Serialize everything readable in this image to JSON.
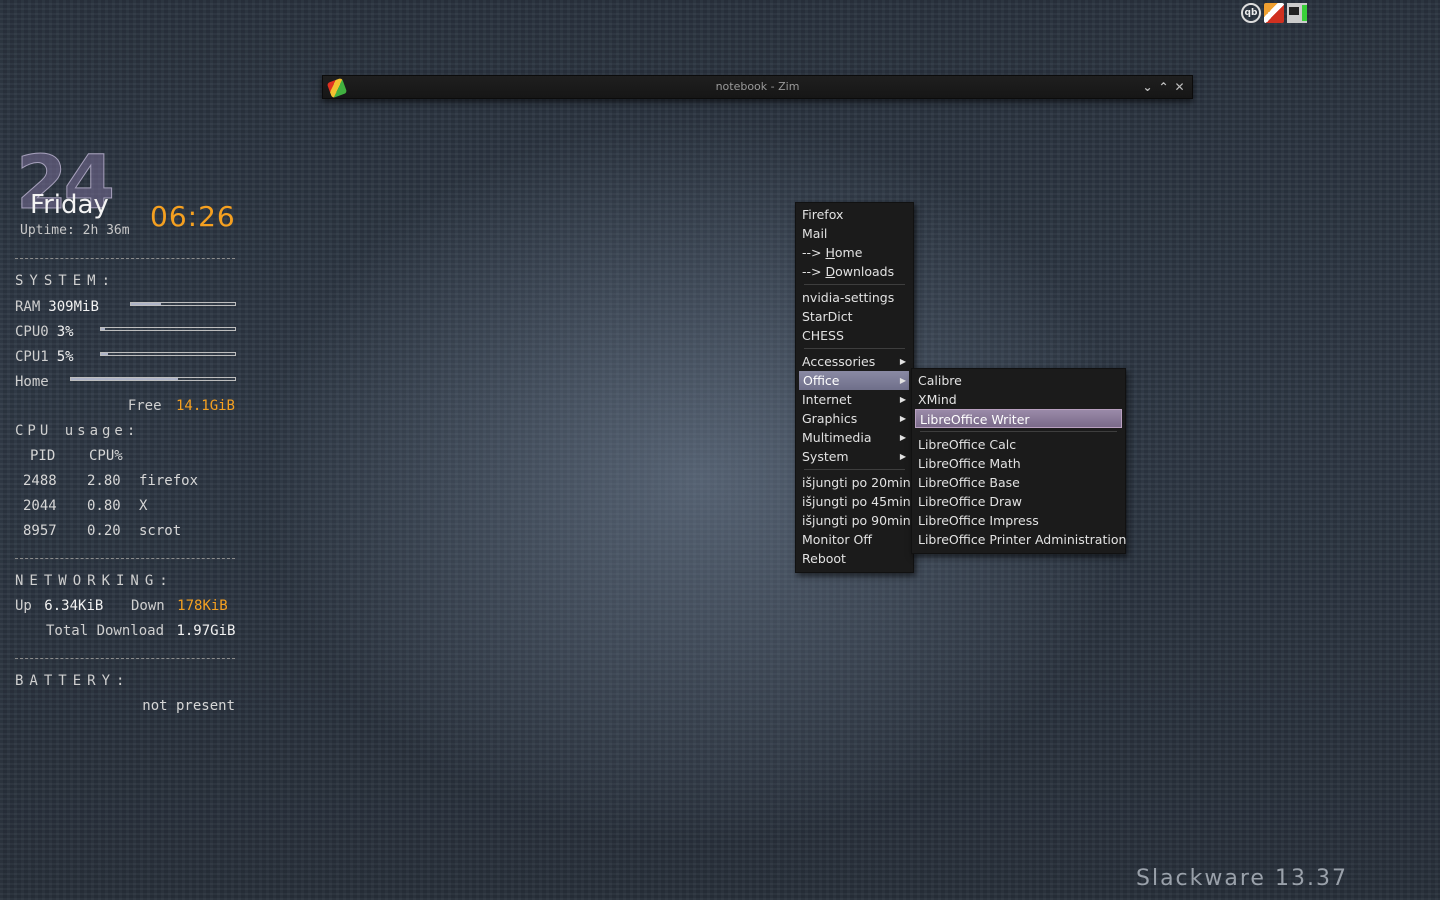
{
  "tray": {
    "qb_label": "qb"
  },
  "window": {
    "title": "notebook - Zim",
    "min_glyph": "⌄",
    "max_glyph": "⌃",
    "close_glyph": "✕"
  },
  "conky": {
    "day_number": "24",
    "day_name": "Friday",
    "time": "06:26",
    "uptime": "Uptime: 2h 36m",
    "system_heading": "SYSTEM:",
    "ram_label": "RAM",
    "ram_value": "309MiB",
    "ram_fraction": 0.29,
    "cpu0_label": "CPU0",
    "cpu0_value": "3%",
    "cpu0_fraction": 0.03,
    "cpu1_label": "CPU1",
    "cpu1_value": "5%",
    "cpu1_fraction": 0.05,
    "home_label": "Home",
    "home_fraction": 0.65,
    "free_label": "Free",
    "free_value": "14.1GiB",
    "cpu_usage_heading": "CPU usage:",
    "proc_headers": {
      "pid": "PID",
      "cpu": "CPU%"
    },
    "processes": [
      {
        "pid": "2488",
        "cpu": "2.80",
        "name": "firefox"
      },
      {
        "pid": "2044",
        "cpu": "0.80",
        "name": "X"
      },
      {
        "pid": "8957",
        "cpu": "0.20",
        "name": "scrot"
      }
    ],
    "networking_heading": "NETWORKING:",
    "up_label": "Up",
    "up_value": "6.34KiB",
    "down_label": "Down",
    "down_value": "178KiB",
    "total_label": "Total Download",
    "total_value": "1.97GiB",
    "battery_heading": "BATTERY:",
    "battery_value": "not present"
  },
  "menu": {
    "firefox": "Firefox",
    "mail": "Mail",
    "home_prefix": "--> ",
    "home_access": "H",
    "home_rest": "ome",
    "downloads_prefix": "--> ",
    "downloads_access": "D",
    "downloads_rest": "ownloads",
    "nvidia": "nvidia-settings",
    "stardict": "StarDict",
    "chess": "CHESS",
    "accessories": "Accessories",
    "office": "Office",
    "internet": "Internet",
    "graphics": "Graphics",
    "multimedia": "Multimedia",
    "system": "System",
    "off20": "išjungti po 20min",
    "off45": "išjungti po 45min",
    "off90": "išjungti po 90min",
    "monitor_off": "Monitor Off",
    "reboot": "Reboot"
  },
  "office_submenu": {
    "calibre": "Calibre",
    "xmind": "XMind",
    "writer": "LibreOffice Writer",
    "calc": "LibreOffice Calc",
    "math": "LibreOffice Math",
    "base": "LibreOffice Base",
    "draw": "LibreOffice Draw",
    "impress": "LibreOffice Impress",
    "printer_admin": "LibreOffice Printer Administration"
  },
  "watermark": "Slackware 13.37",
  "colors": {
    "accent": "#f5a020",
    "menu_selected": "#7a7a96",
    "menu_bg": "#1b1b1b"
  }
}
